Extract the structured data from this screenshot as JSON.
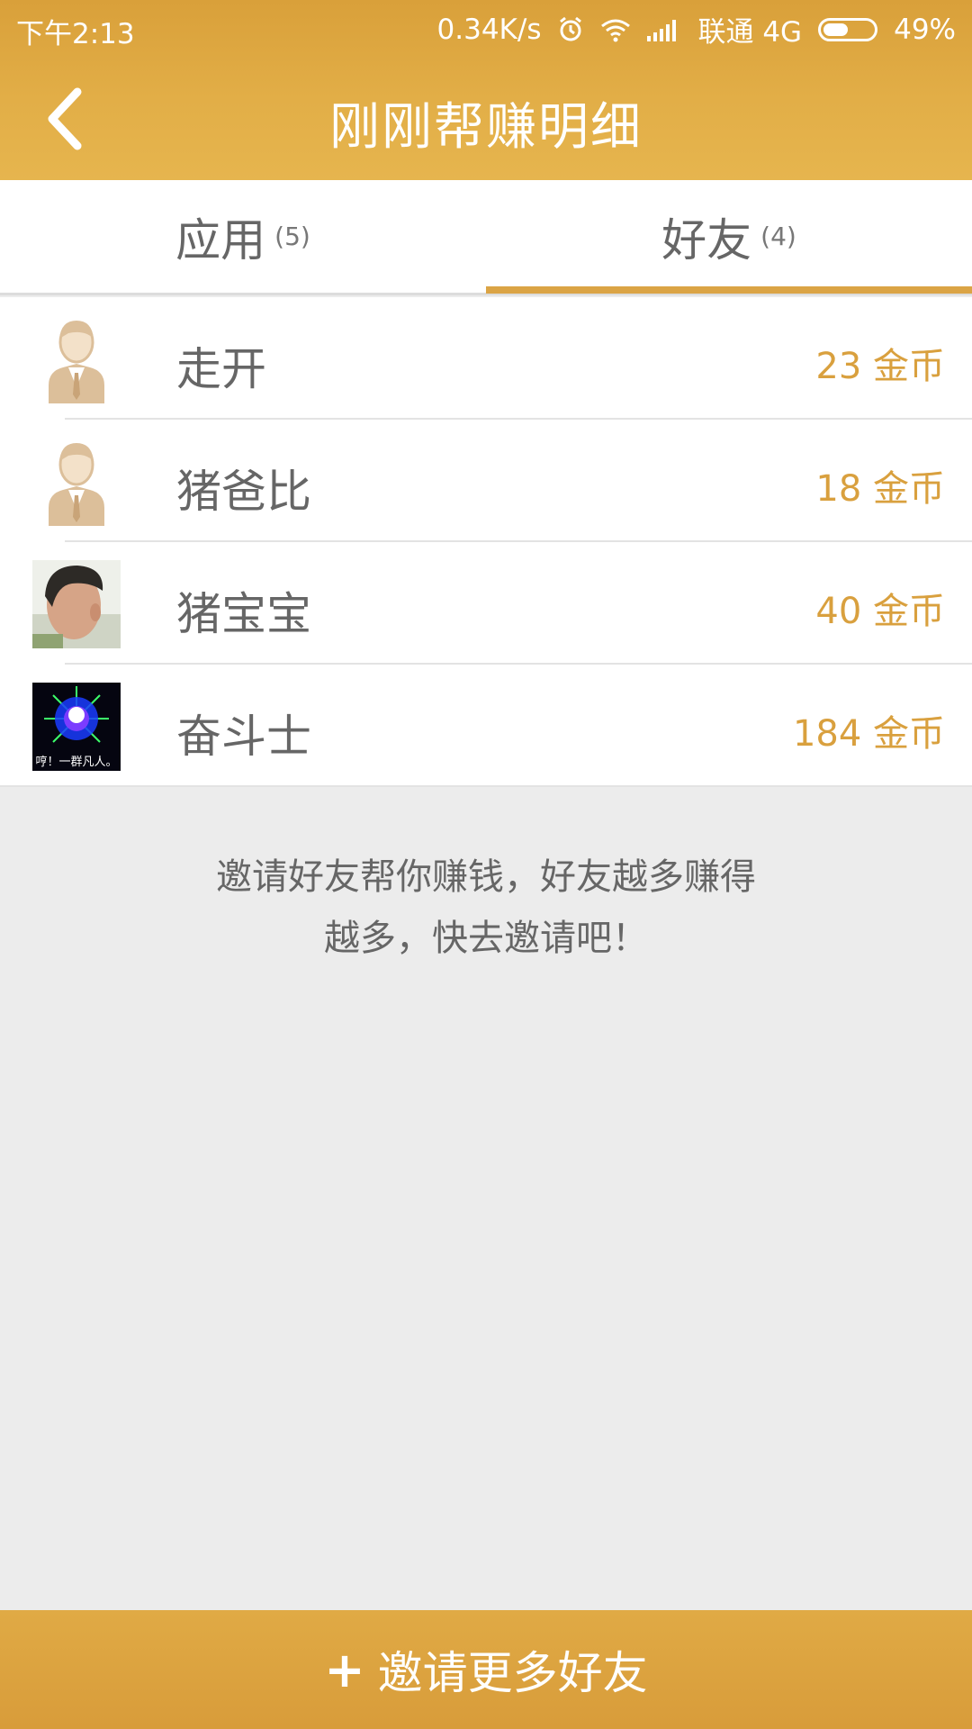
{
  "status_bar": {
    "time": "下午2:13",
    "speed": "0.34K/s",
    "carrier": "联通 4G",
    "battery": "49%",
    "battery_level": 0.49,
    "icons": [
      "alarm-icon",
      "wifi-icon",
      "signal-icon",
      "battery-icon"
    ]
  },
  "header": {
    "title": "刚刚帮赚明细",
    "back_icon": "chevron-left-icon"
  },
  "tabs": [
    {
      "label": "应用",
      "count": "(5)",
      "active": false
    },
    {
      "label": "好友",
      "count": "(4)",
      "active": true
    }
  ],
  "friends": [
    {
      "name": "走开",
      "coins": "23 金币",
      "avatar": "default-user"
    },
    {
      "name": "猪爸比",
      "coins": "18 金币",
      "avatar": "default-user"
    },
    {
      "name": "猪宝宝",
      "coins": "40 金币",
      "avatar": "photo"
    },
    {
      "name": "奋斗士",
      "coins": "184 金币",
      "avatar": "image"
    }
  ],
  "avatar_text": "哼！一群凡人。",
  "hint": {
    "line1": "邀请好友帮你赚钱，好友越多赚得",
    "line2": "越多，快去邀请吧！"
  },
  "bottom_button": {
    "plus": "+",
    "label": "邀请更多好友"
  },
  "colors": {
    "accent": "#dba445",
    "coins": "#d9a03e",
    "background": "#ececec"
  }
}
